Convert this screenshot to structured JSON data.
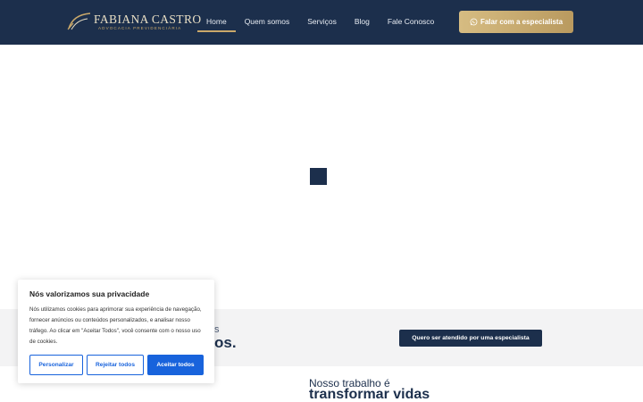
{
  "header": {
    "logo": {
      "name": "FABIANA CASTRO",
      "tagline": "ADVOCACIA PREVIDENCIÁRIA",
      "icon": "logo-swoosh-icon"
    },
    "nav": [
      {
        "label": "Home",
        "active": true
      },
      {
        "label": "Quem somos",
        "active": false
      },
      {
        "label": "Serviços",
        "active": false
      },
      {
        "label": "Blog",
        "active": false
      },
      {
        "label": "Fale Conosco",
        "active": false
      }
    ],
    "cta": {
      "label": "Falar com a especialista",
      "icon": "whatsapp-icon"
    }
  },
  "band": {
    "small_text": "s",
    "big_text": "os.",
    "button_label": "Quero ser atendido por uma especialista"
  },
  "section": {
    "small_text": "Nosso trabalho é",
    "big_text": "transformar vidas"
  },
  "cookie": {
    "title": "Nós valorizamos sua privacidade",
    "body": "Nós utilizamos cookies para aprimorar sua experiência de navegação, fornecer anúncios ou conteúdos personalizados, e analisar nosso tráfego. Ao clicar em \"Aceitar Todos\", você consente com o nosso uso de cookies.",
    "buttons": {
      "customize": "Personalizar",
      "reject": "Rejeitar todos",
      "accept": "Aceitar todos"
    }
  },
  "colors": {
    "navy": "#1c2f4c",
    "gold": "#c9a86a",
    "cookie_blue": "#1863dc"
  }
}
